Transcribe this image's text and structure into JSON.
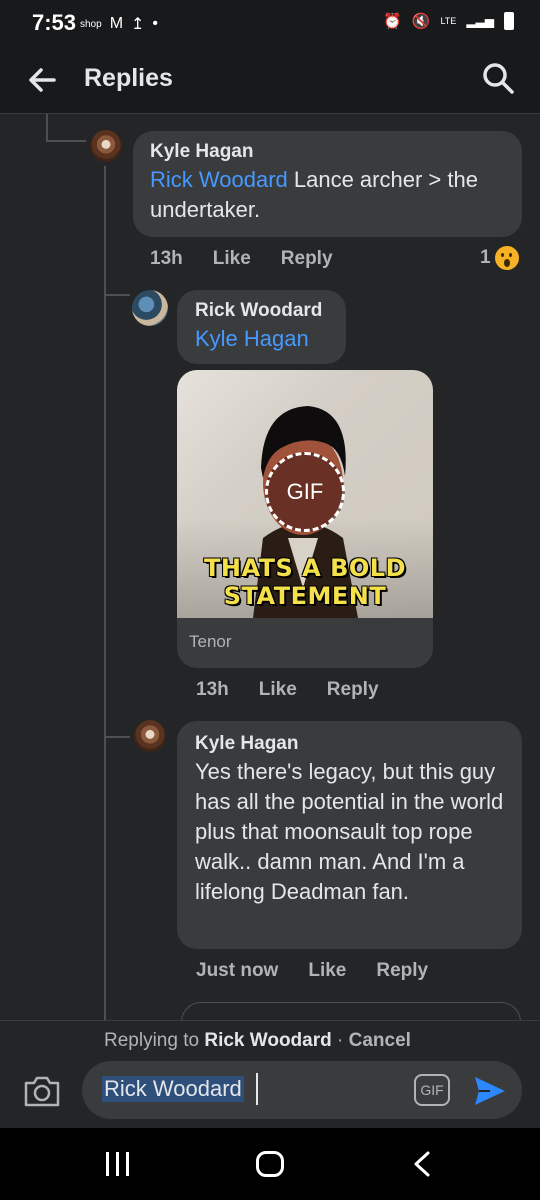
{
  "status_bar": {
    "time": "7:53",
    "left_icons": [
      "shop",
      "M",
      "upload-icon",
      "dot"
    ],
    "right": {
      "network": "LTE"
    }
  },
  "header": {
    "title": "Replies",
    "back_icon": "arrow-left-icon",
    "search_icon": "search-icon"
  },
  "comments": [
    {
      "author": "Kyle Hagan",
      "mention": "Rick Woodard",
      "text": " Lance archer > the undertaker.",
      "time": "13h",
      "like": "Like",
      "reply": "Reply",
      "reaction_count": "1",
      "reaction": "wow"
    },
    {
      "author": "Rick Woodard",
      "mention": "Kyle Hagan",
      "gif": {
        "caption_line1": "THATS A BOLD",
        "caption_line2": "STATEMENT",
        "badge": "GIF",
        "source": "Tenor"
      },
      "time": "13h",
      "like": "Like",
      "reply": "Reply"
    },
    {
      "author": "Kyle Hagan",
      "text": "Yes there's legacy, but this guy has all the potential in the world plus that moonsault top rope walk.. damn man. And I'm a lifelong Deadman fan.",
      "time": "Just now",
      "like": "Like",
      "reply": "Reply"
    }
  ],
  "composer": {
    "replying_prefix": "Replying to ",
    "replying_to": "Rick Woodard",
    "separator": " · ",
    "cancel": "Cancel",
    "input_value": "Rick Woodard",
    "gif_button": "GIF",
    "camera_icon": "camera-icon",
    "send_icon": "send-icon"
  },
  "colors": {
    "background": "#242526",
    "bubble": "#3a3b3c",
    "mention": "#4599ff",
    "send": "#2d88ff"
  }
}
